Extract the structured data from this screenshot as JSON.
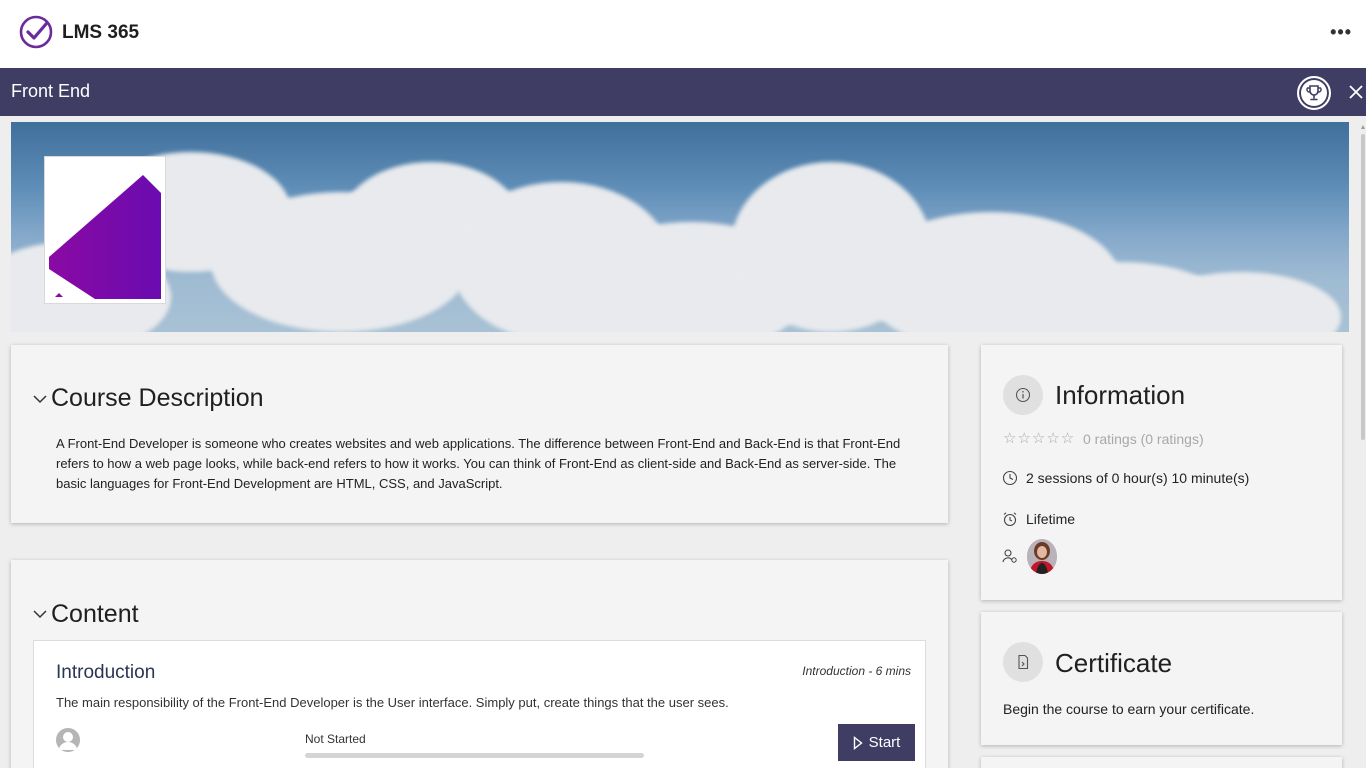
{
  "app": {
    "name": "LMS 365",
    "more_label": "•••"
  },
  "course": {
    "title": "Front End"
  },
  "colors": {
    "header_bar": "#3f3d64",
    "accent_purple": "#7a0aa8",
    "start_button": "#3f3d64"
  },
  "description": {
    "heading": "Course Description",
    "text": "A Front-End Developer is someone who creates websites and web applications. The difference between Front-End and Back-End is that Front-End refers to how a web page looks, while back-end refers to how it works. You can think of Front-End as client-side and Back-End as server-side. The basic languages for Front-End Development are HTML, CSS, and JavaScript."
  },
  "content": {
    "heading": "Content",
    "lessons": [
      {
        "title": "Introduction",
        "meta": "Introduction - 6 mins",
        "description": "The main responsibility of the Front-End Developer is the User interface. Simply put, create things that the user sees.",
        "status": "Not Started",
        "progress": 0,
        "start_label": "Start"
      }
    ]
  },
  "information": {
    "heading": "Information",
    "stars": "☆☆☆☆☆",
    "ratings": "0 ratings (0 ratings)",
    "sessions": "2 sessions of 0 hour(s) 10 minute(s)",
    "access": "Lifetime"
  },
  "certificate": {
    "heading": "Certificate",
    "text": "Begin the course to earn your certificate."
  },
  "icons": [
    "app-logo-icon",
    "more-icon",
    "trophy-icon",
    "close-icon",
    "chevron-down-icon",
    "info-icon",
    "clock-icon",
    "alarm-icon",
    "people-icon",
    "certificate-icon",
    "play-icon",
    "user-avatar-icon"
  ]
}
